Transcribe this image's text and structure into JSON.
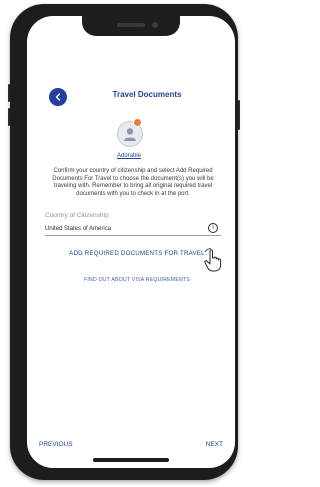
{
  "header": {
    "title": "Travel Documents"
  },
  "profile": {
    "name": "Adorable"
  },
  "instructions": "Confirm your country of citizenship and select Add Required Documents For Travel to choose the document(s) you will be traveling with. Remember to bring all original required travel documents with you to check in at the port.",
  "citizenship": {
    "label": "Country of Citizenship",
    "value": "United States of America"
  },
  "actions": {
    "add_docs_label": "ADD REQUIRED DOCUMENTS FOR TRAVEL",
    "visa_link_label": "FIND OUT ABOUT VISA REQUIREMENTS"
  },
  "footer": {
    "previous_label": "PREVIOUS",
    "next_label": "NEXT"
  },
  "colors": {
    "accent": "#24409a",
    "badge": "#f07a3c"
  },
  "icons": {
    "back": "arrow-left-icon",
    "info": "info-icon",
    "pointer": "hand-pointer-icon"
  }
}
